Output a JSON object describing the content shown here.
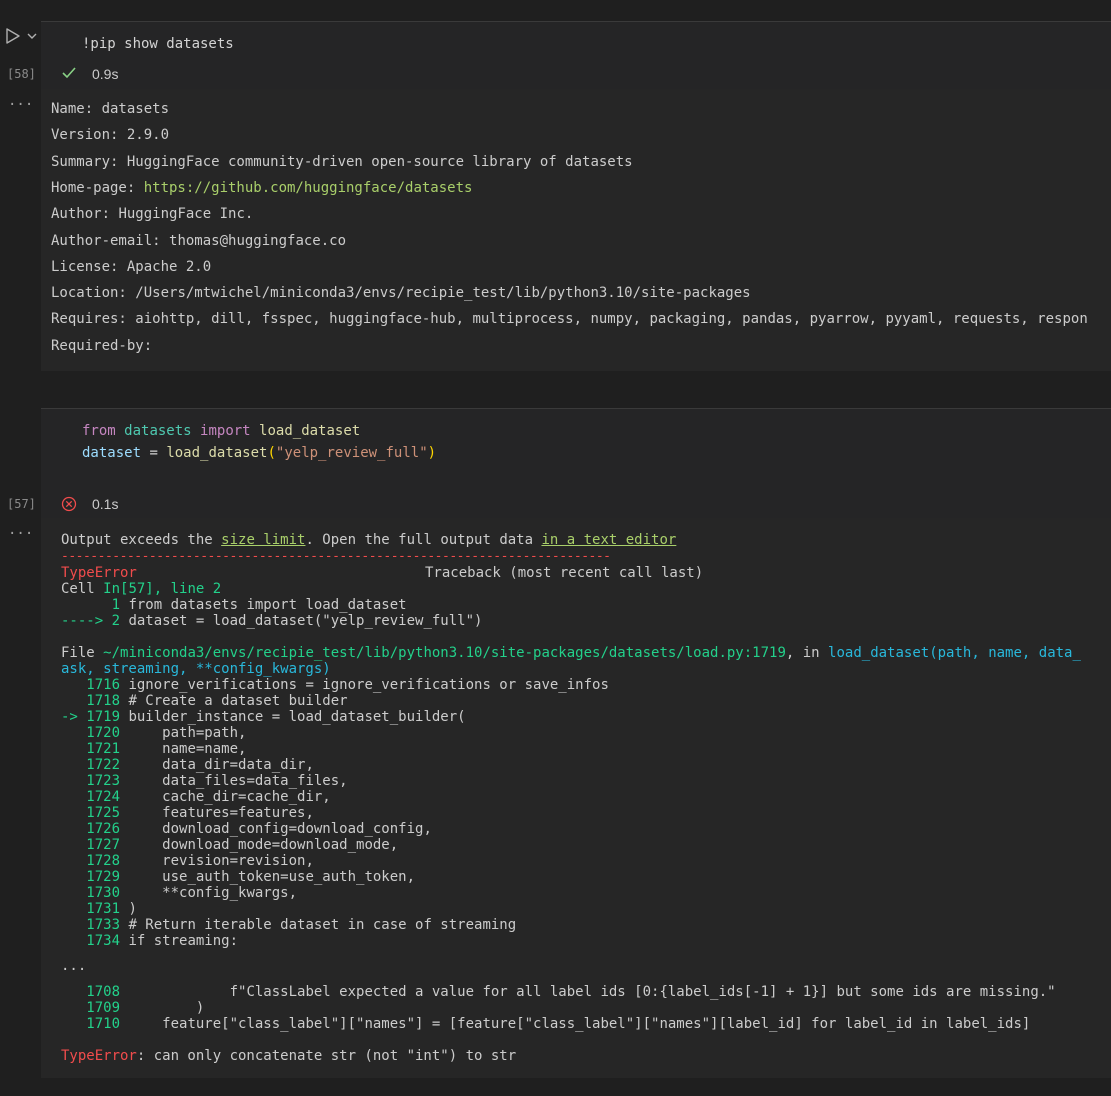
{
  "cell1": {
    "code": "!pip show datasets",
    "exec_count": "[58]",
    "status_icon": "check-icon",
    "duration": "0.9s",
    "output_lines": [
      {
        "key": "Name: ",
        "value": "datasets"
      },
      {
        "key": "Version: ",
        "value": "2.9.0"
      },
      {
        "key": "Summary: ",
        "value": "HuggingFace community-driven open-source library of datasets"
      },
      {
        "key": "Home-page: ",
        "value": "https://github.com/huggingface/datasets"
      },
      {
        "key": "Author: ",
        "value": "HuggingFace Inc."
      },
      {
        "key": "Author-email: ",
        "value": "thomas@huggingface.co"
      },
      {
        "key": "License: ",
        "value": "Apache 2.0"
      },
      {
        "key": "Location: ",
        "value": "/Users/mtwichel/miniconda3/envs/recipie_test/lib/python3.10/site-packages"
      },
      {
        "key": "Requires: ",
        "value": "aiohttp, dill, fsspec, huggingface-hub, multiprocess, numpy, packaging, pandas, pyarrow, pyyaml, requests, respon"
      },
      {
        "key": "Required-by:",
        "value": ""
      }
    ]
  },
  "cell2": {
    "code_line1": {
      "kw1": "from",
      "mod": "datasets",
      "kw2": "import",
      "fn": "load_dataset"
    },
    "code_line2": {
      "var": "dataset",
      "eq": " = ",
      "fn": "load_dataset",
      "open": "(",
      "str": "\"yelp_review_full\"",
      "close": ")"
    },
    "exec_count": "[57]",
    "status_icon": "error-circle-icon",
    "duration": "0.1s",
    "output_notice": {
      "prefix": "Output exceeds the ",
      "link1": "size limit",
      "middle": ". Open the full output data ",
      "link2": "in a text editor"
    },
    "traceback": {
      "separator": "---------------------------------------------------------------------------",
      "error_name": "TypeError",
      "header_right": "Traceback (most recent call last)",
      "cell_ref_prefix": "Cell ",
      "cell_ref": "In[57], line 2",
      "line1_num": "      1",
      "line1_code": " from datasets import load_dataset",
      "arrow": "----> 2",
      "line2_code": " dataset = load_dataset(\"yelp_review_full\")",
      "file_prefix": "File ",
      "file_path": "~/miniconda3/envs/recipie_test/lib/python3.10/site-packages/datasets/load.py:1719",
      "file_in": ", in ",
      "file_fn": "load_dataset(path, name, data_",
      "file_cont": "ask, streaming, **config_kwargs)",
      "src_lines": [
        {
          "num": "   1716",
          "code": " ignore_verifications = ignore_verifications or save_infos"
        },
        {
          "num": "   1718",
          "code": " # Create a dataset builder"
        },
        {
          "num": "-> 1719",
          "code": " builder_instance = load_dataset_builder("
        },
        {
          "num": "   1720",
          "code": "     path=path,"
        },
        {
          "num": "   1721",
          "code": "     name=name,"
        },
        {
          "num": "   1722",
          "code": "     data_dir=data_dir,"
        },
        {
          "num": "   1723",
          "code": "     data_files=data_files,"
        },
        {
          "num": "   1724",
          "code": "     cache_dir=cache_dir,"
        },
        {
          "num": "   1725",
          "code": "     features=features,"
        },
        {
          "num": "   1726",
          "code": "     download_config=download_config,"
        },
        {
          "num": "   1727",
          "code": "     download_mode=download_mode,"
        },
        {
          "num": "   1728",
          "code": "     revision=revision,"
        },
        {
          "num": "   1729",
          "code": "     use_auth_token=use_auth_token,"
        },
        {
          "num": "   1730",
          "code": "     **config_kwargs,"
        },
        {
          "num": "   1731",
          "code": " )"
        },
        {
          "num": "   1733",
          "code": " # Return iterable dataset in case of streaming"
        },
        {
          "num": "   1734",
          "code": " if streaming:"
        }
      ],
      "ellipsis": "...",
      "tail_lines": [
        {
          "num": "   1708",
          "code": "             f\"ClassLabel expected a value for all label ids [0:{label_ids[-1] + 1}] but some ids are missing.\""
        },
        {
          "num": "   1709",
          "code": "         )"
        },
        {
          "num": "   1710",
          "code": "     feature[\"class_label\"][\"names\"] = [feature[\"class_label\"][\"names\"][label_id] for label_id in label_ids]"
        }
      ],
      "final_error_name": "TypeError",
      "final_error_msg": ": can only concatenate str (not \"int\") to str"
    }
  },
  "icons": {
    "run": "run-triangle-icon",
    "chevron": "chevron-down-icon",
    "more": "ellipsis-icon"
  }
}
